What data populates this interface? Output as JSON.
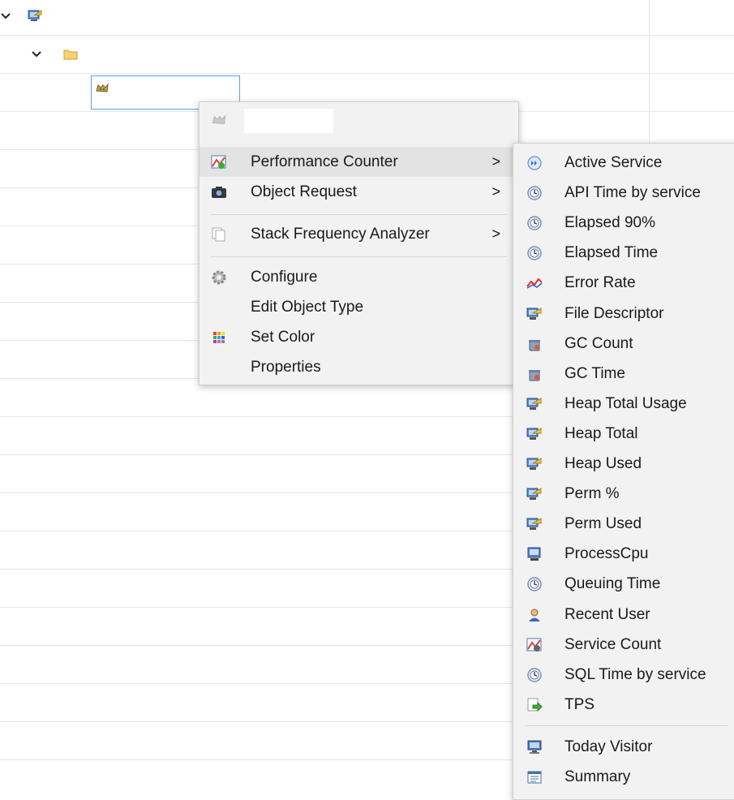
{
  "main_menu": {
    "items": [
      {
        "label": "Performance Counter",
        "icon": "performance-chart-icon",
        "has_submenu": true
      },
      {
        "label": "Object Request",
        "icon": "camera-icon",
        "has_submenu": true
      },
      {
        "label": "Stack Frequency Analyzer",
        "icon": "copy-pages-icon",
        "has_submenu": true
      },
      {
        "label": "Configure",
        "icon": "gear-icon",
        "has_submenu": false
      },
      {
        "label": "Edit Object Type",
        "icon": "",
        "has_submenu": false
      },
      {
        "label": "Set Color",
        "icon": "color-grid-icon",
        "has_submenu": false
      },
      {
        "label": "Properties",
        "icon": "",
        "has_submenu": false
      }
    ],
    "arrow": ">"
  },
  "sub_menu": {
    "items": [
      {
        "label": "Active Service",
        "icon": "play-circle-icon"
      },
      {
        "label": "API Time by service",
        "icon": "clock-icon"
      },
      {
        "label": "Elapsed 90%",
        "icon": "clock-icon"
      },
      {
        "label": "Elapsed Time",
        "icon": "clock-icon"
      },
      {
        "label": "Error Rate",
        "icon": "error-line-icon"
      },
      {
        "label": "File Descriptor",
        "icon": "monitor-icon"
      },
      {
        "label": "GC Count",
        "icon": "gc-bin-icon"
      },
      {
        "label": "GC Time",
        "icon": "gc-bin-icon"
      },
      {
        "label": "Heap Total Usage",
        "icon": "monitor-icon"
      },
      {
        "label": "Heap Total",
        "icon": "monitor-icon"
      },
      {
        "label": "Heap Used",
        "icon": "monitor-icon"
      },
      {
        "label": "Perm %",
        "icon": "monitor-icon"
      },
      {
        "label": "Perm Used",
        "icon": "monitor-icon"
      },
      {
        "label": "ProcessCpu",
        "icon": "cpu-icon"
      },
      {
        "label": "Queuing Time",
        "icon": "clock-icon"
      },
      {
        "label": "Recent User",
        "icon": "user-icon"
      },
      {
        "label": "Service Count",
        "icon": "service-chart-icon"
      },
      {
        "label": "SQL Time by service",
        "icon": "clock-icon"
      },
      {
        "label": "TPS",
        "icon": "tps-arrow-icon"
      },
      {
        "label": "Today Visitor",
        "icon": "computer-icon"
      },
      {
        "label": "Summary",
        "icon": "summary-table-icon"
      }
    ]
  },
  "colors": {
    "menu_bg": "#f2f2f2",
    "highlight": "#e3e3e3",
    "edit_border": "#5aa0e8"
  }
}
